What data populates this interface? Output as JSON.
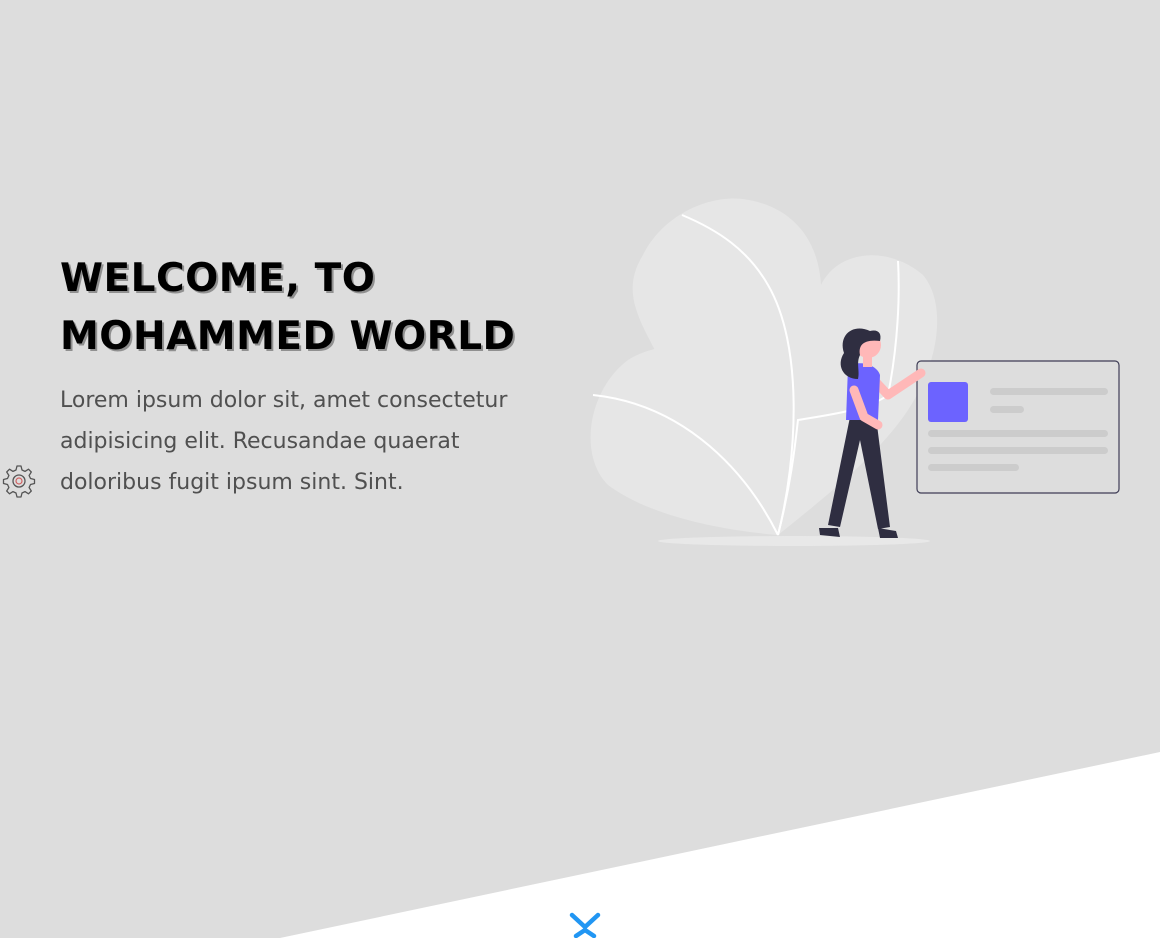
{
  "hero": {
    "title": "WELCOME, TO\nMOHAMMED WORLD",
    "description": "Lorem ipsum dolor sit, amet consectetur adipisicing elit. Recusandae quaerat doloribus fugit ipsum sint. Sint."
  },
  "icons": {
    "settings": "gear-icon",
    "scroll": "chevron-down-icon"
  },
  "colors": {
    "hero_background": "#dddddd",
    "accent_purple": "#6c63ff",
    "chevron_blue": "#2196f3",
    "text_dark": "#000000",
    "text_muted": "#505050"
  }
}
